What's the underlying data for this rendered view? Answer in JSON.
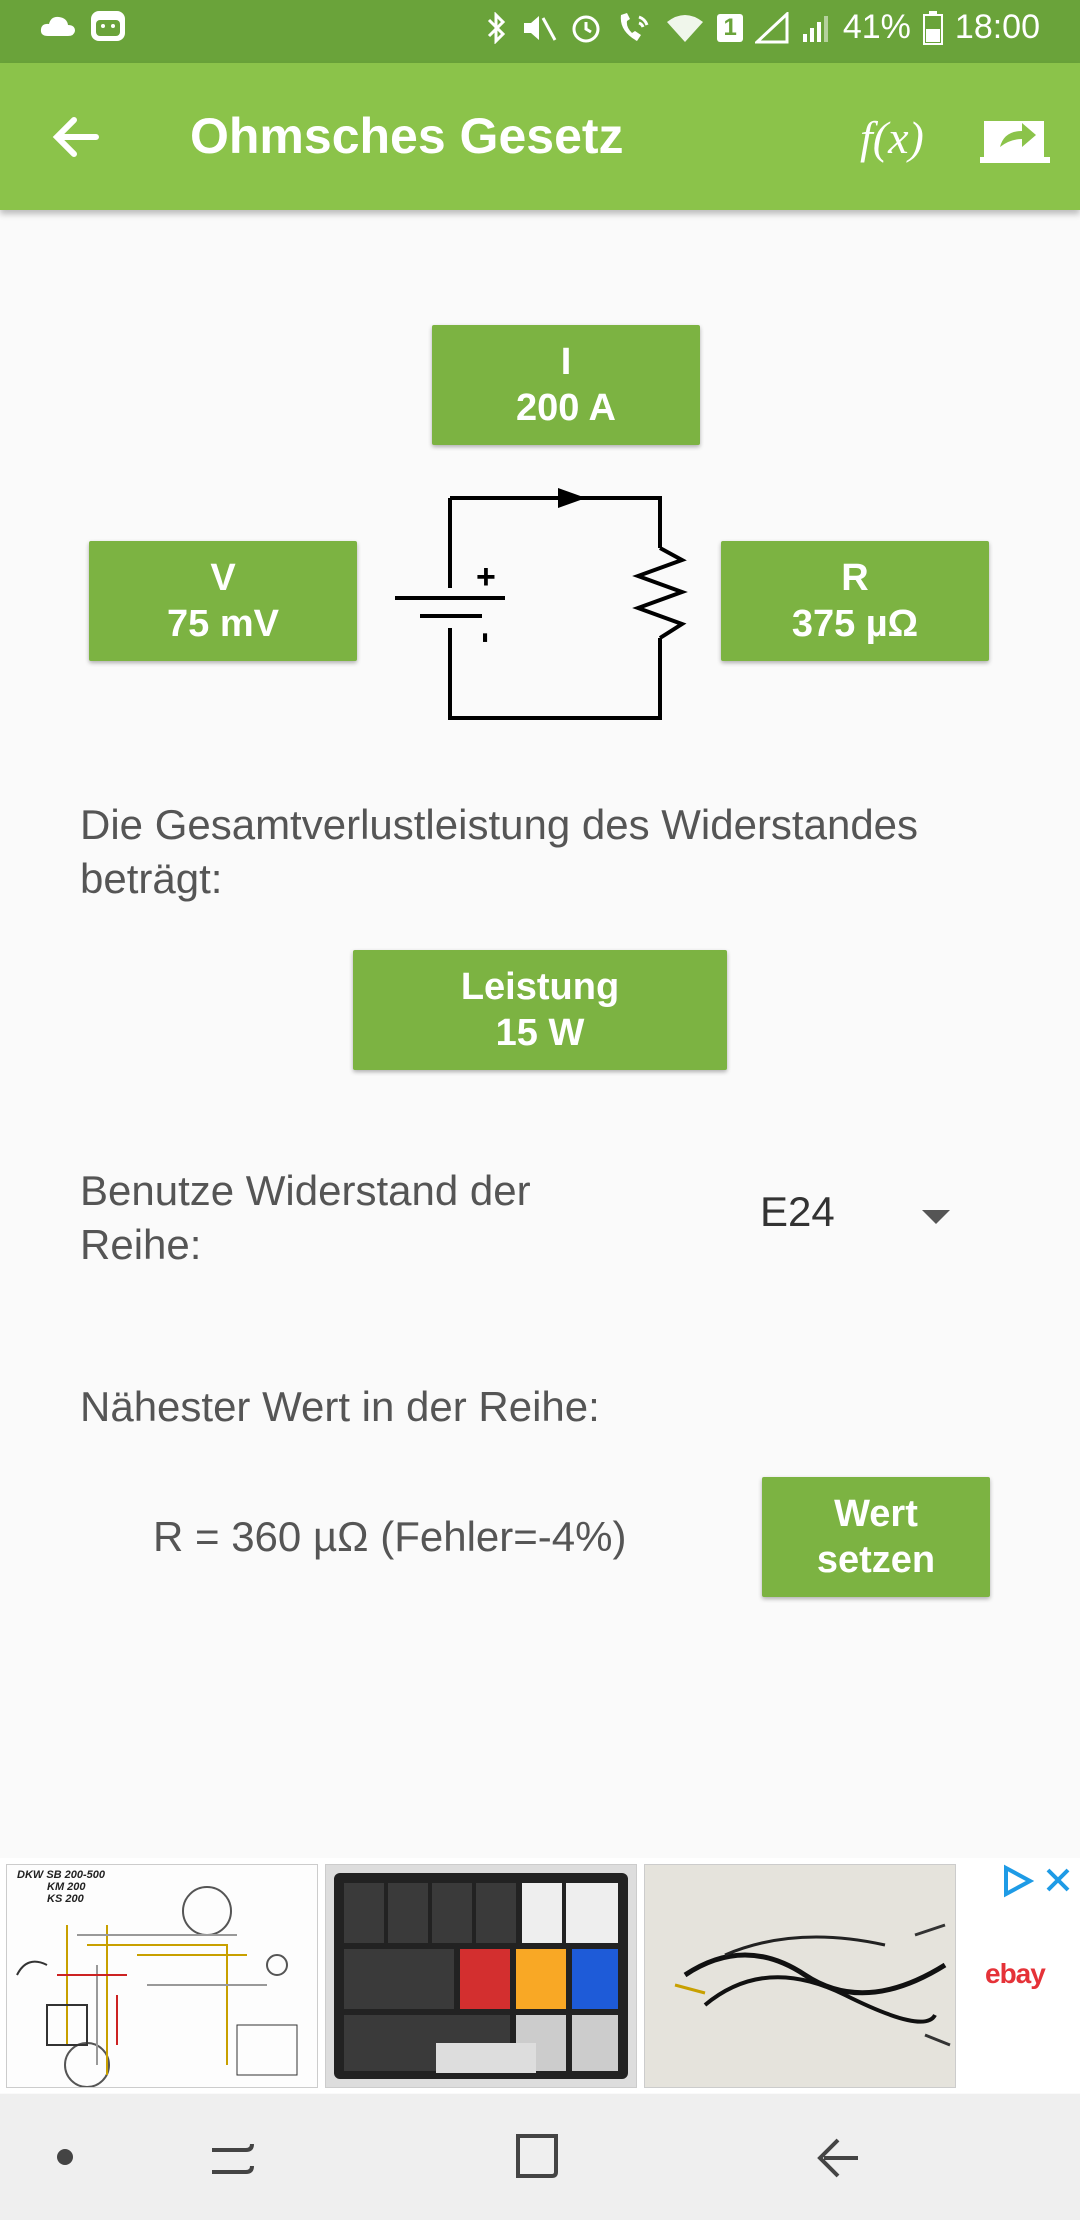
{
  "status": {
    "battery": "41%",
    "time": "18:00",
    "sim": "1"
  },
  "appbar": {
    "title": "Ohmsches Gesetz",
    "fx_label": "f(x)"
  },
  "current": {
    "label": "I",
    "value": "200 A"
  },
  "voltage": {
    "label": "V",
    "value": "75 mV"
  },
  "resistance": {
    "label": "R",
    "value": "375 µΩ"
  },
  "circuit": {
    "plus": "+",
    "minus": "-"
  },
  "power_text": "Die Gesamtverlustleistung des Widerstandes beträgt:",
  "power": {
    "label": "Leistung",
    "value": "15 W"
  },
  "series": {
    "label": "Benutze Widerstand der Reihe:",
    "selected": "E24"
  },
  "nearest": {
    "label": "Nähester Wert in der Reihe:",
    "value": "R = 360 µΩ  (Fehler=-4%)",
    "button_line1": "Wert",
    "button_line2": "setzen"
  },
  "ad": {
    "brand": "ebay",
    "thumb1_lines": [
      "DKW SB 200-500",
      "KM 200",
      "KS 200"
    ]
  },
  "colors": {
    "statusbar": "#6aa33a",
    "appbar": "#8bc34a",
    "button": "#7cb342"
  }
}
